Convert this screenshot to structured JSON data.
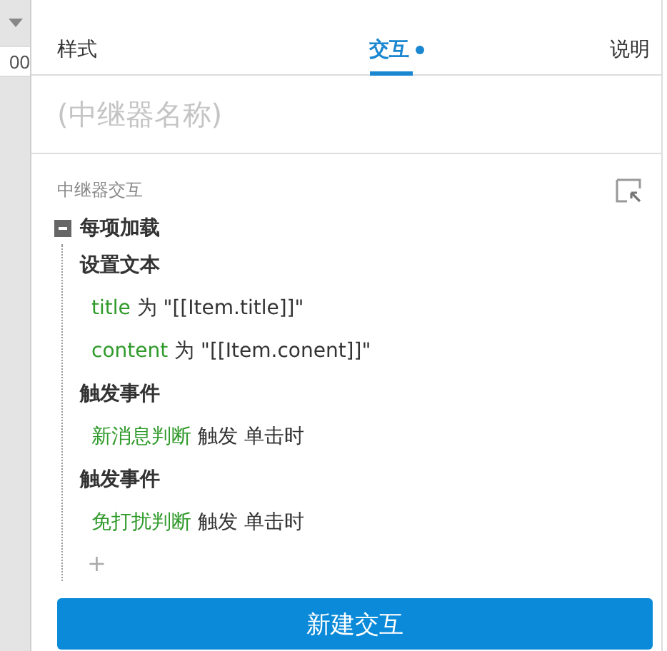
{
  "left_strip": {
    "cell_text": "00"
  },
  "tabs": [
    {
      "label": "样式",
      "selected": false,
      "modified": false
    },
    {
      "label": "交互",
      "selected": true,
      "modified": true
    },
    {
      "label": "说明",
      "selected": false,
      "modified": false
    }
  ],
  "name_field": {
    "placeholder": "(中继器名称)"
  },
  "section": {
    "title": "中继器交互"
  },
  "event": {
    "label": "每项加载",
    "expanded": true,
    "actions": [
      {
        "label": "设置文本",
        "lines": [
          {
            "target": "title",
            "text": "为 \"[[Item.title]]\""
          },
          {
            "target": "content",
            "text": "为 \"[[Item.conent]]\""
          }
        ]
      },
      {
        "label": "触发事件",
        "lines": [
          {
            "target": "新消息判断",
            "text": "触发 单击时"
          }
        ]
      },
      {
        "label": "触发事件",
        "lines": [
          {
            "target": "免打扰判断",
            "text": "触发 单击时"
          }
        ]
      }
    ]
  },
  "add_symbol": "+",
  "new_button": "新建交互"
}
